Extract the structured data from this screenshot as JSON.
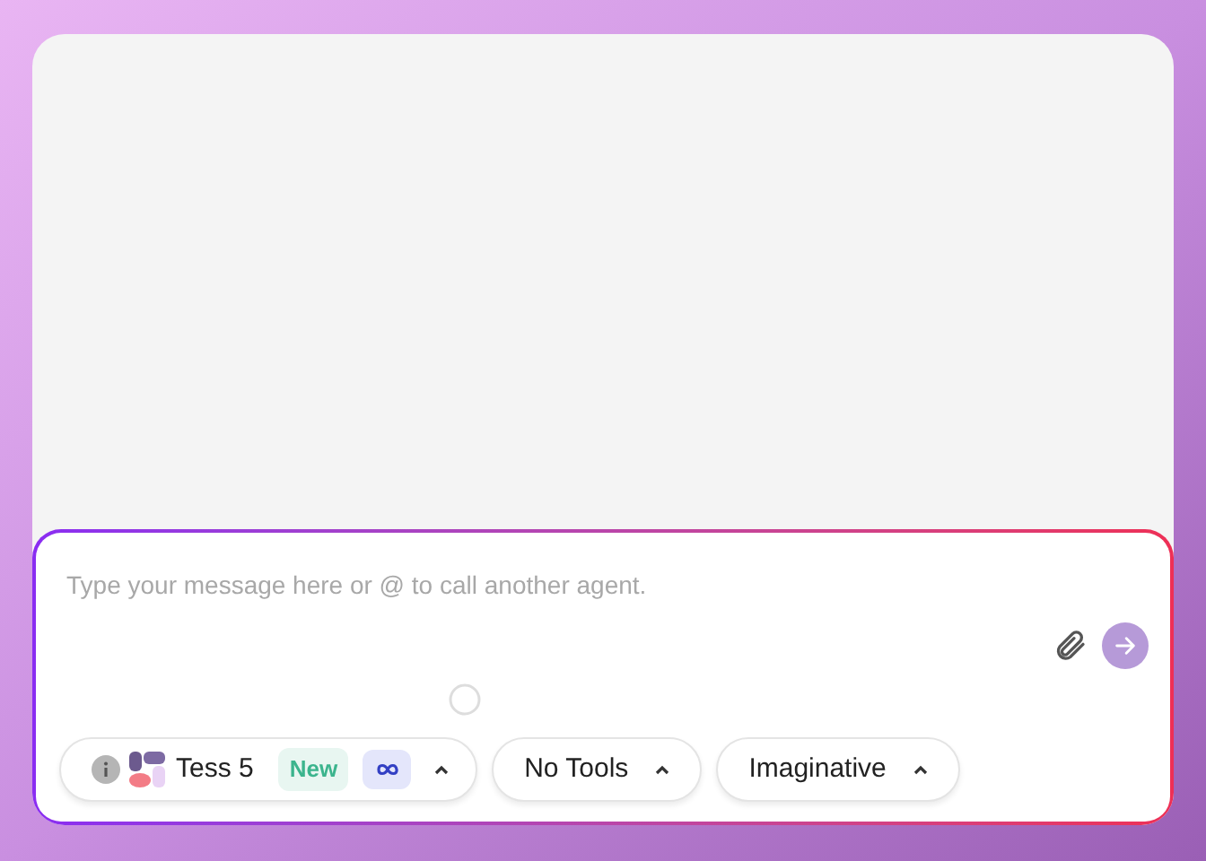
{
  "composer": {
    "placeholder": "Type your message here or @ to call another agent."
  },
  "agent": {
    "name": "Tess 5",
    "badge": "New"
  },
  "dropdowns": [
    {
      "label": "No Tools"
    },
    {
      "label": "Imaginative"
    }
  ]
}
